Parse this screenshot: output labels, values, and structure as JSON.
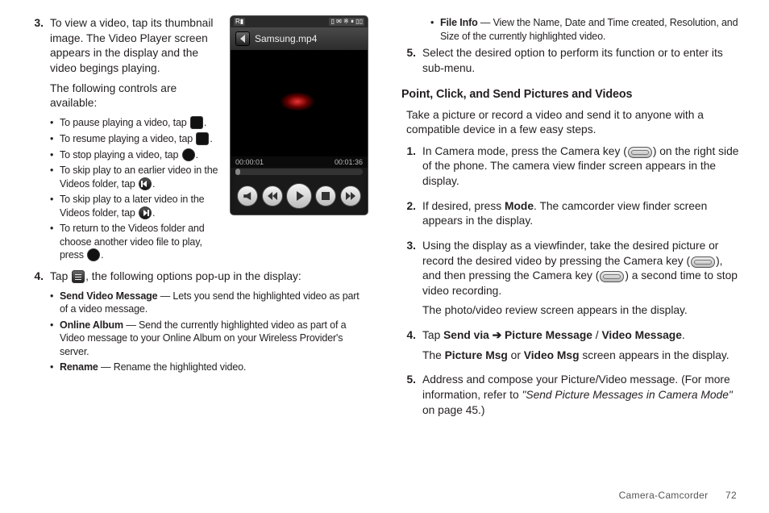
{
  "left": {
    "items": [
      {
        "num": "3.",
        "p1": "To view a video, tap its thumbnail image. The Video Player screen appears in the display and the video begings playing.",
        "p2": "The following controls are available:",
        "bullets": [
          "To pause playing a video, tap",
          "To resume playing a video, tap",
          "To stop playing a video, tap",
          "To skip play to an earlier video in the Videos folder, tap",
          "To skip play to a later video in the Videos folder, tap",
          "To return to the Videos folder and choose another video file to play, press"
        ]
      },
      {
        "num": "4.",
        "p1a": "Tap ",
        "p1b": ", the following options pop-up in the display:",
        "opts": [
          {
            "b": "Send Video Message",
            "t": " — Lets you send the highlighted video as part of a video message."
          },
          {
            "b": "Online Album",
            "t": " — Send the currently highlighted video as part of a Video message to your Online Album on your Wireless Provider's server."
          },
          {
            "b": "Rename",
            "t": " — Rename the highlighted video."
          }
        ]
      }
    ]
  },
  "player": {
    "filename": "Samsung.mp4",
    "time_elapsed": "00:00:01",
    "time_total": "00:01:36"
  },
  "right": {
    "cont": {
      "b": "File Info",
      "t": " — View the Name, Date and Time created, Resolution, and Size of the currently highlighted video."
    },
    "step5": "Select the desired option to perform its function or to enter its sub-menu.",
    "heading": "Point, Click, and Send Pictures and Videos",
    "intro": "Take a picture or record a video and send it to anyone with a compatible device in a few easy steps.",
    "steps": [
      {
        "num": "1.",
        "parts": [
          "In Camera mode, press the Camera key (",
          ") on the right side of the phone. The camera view finder screen appears in the display."
        ]
      },
      {
        "num": "2.",
        "parts": [
          "If desired, press ",
          "Mode",
          ". The camcorder view finder screen appears in the display."
        ]
      },
      {
        "num": "3.",
        "p1": [
          "Using the display as a viewfinder, take the desired picture or record the desired video by pressing the Camera key (",
          "), and then pressing the Camera key (",
          ") a second time to stop video recording."
        ],
        "p2": "The photo/video review screen appears in the display."
      },
      {
        "num": "4.",
        "parts": [
          "Tap ",
          "Send via ➔ Picture Message",
          " / ",
          "Video Message",
          "."
        ],
        "p2a": "The ",
        "p2b": "Picture Msg",
        "p2c": " or ",
        "p2d": "Video Msg",
        "p2e": " screen appears in the display."
      },
      {
        "num": "5.",
        "parts": [
          "Address and compose your Picture/Video message. (For more information, refer to ",
          "\"Send Picture Messages in Camera Mode\"",
          "  on page 45.)"
        ]
      }
    ]
  },
  "footer": {
    "section": "Camera-Camcorder",
    "page": "72"
  }
}
